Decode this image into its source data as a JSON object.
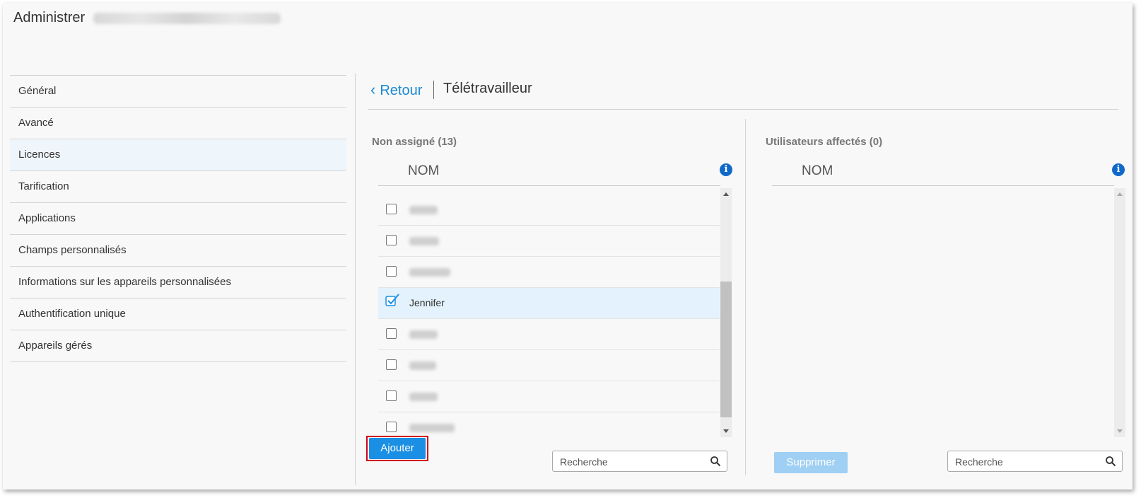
{
  "header": {
    "title": "Administrer"
  },
  "sidebar": {
    "items": [
      {
        "label": "Général"
      },
      {
        "label": "Avancé"
      },
      {
        "label": "Licences",
        "active": true
      },
      {
        "label": "Tarification"
      },
      {
        "label": "Applications"
      },
      {
        "label": "Champs personnalisés"
      },
      {
        "label": "Informations sur les appareils personnalisées"
      },
      {
        "label": "Authentification unique"
      },
      {
        "label": "Appareils gérés"
      }
    ]
  },
  "main": {
    "back_label": "Retour",
    "page_title": "Télétravailleur",
    "unassigned": {
      "title": "Non assigné (13)",
      "column_header": "NOM",
      "rows": [
        {
          "name": "",
          "checked": false
        },
        {
          "name": "",
          "checked": false
        },
        {
          "name": "",
          "checked": false
        },
        {
          "name": "Jennifer",
          "checked": true
        },
        {
          "name": "",
          "checked": false
        },
        {
          "name": "",
          "checked": false
        },
        {
          "name": "",
          "checked": false
        },
        {
          "name": "",
          "checked": false
        }
      ],
      "add_button": "Ajouter",
      "search_placeholder": "Recherche"
    },
    "assigned": {
      "title": "Utilisateurs affectés (0)",
      "column_header": "NOM",
      "remove_button": "Supprimer",
      "search_placeholder": "Recherche"
    }
  },
  "colors": {
    "accent": "#1a8fe3",
    "link": "#1b8ad3",
    "highlight": "#d0021b",
    "selected_row": "#e3f2fc"
  },
  "icons": {
    "back": "chevron-left-icon",
    "info": "info-icon",
    "search": "search-icon",
    "check": "check-icon"
  }
}
